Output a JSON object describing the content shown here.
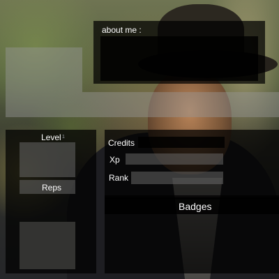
{
  "profile": {
    "about_label": "about me :",
    "level_label": "Level",
    "level_value": "1",
    "reps_label": "Reps",
    "credits_label": "Credits",
    "xp_label": "Xp",
    "rank_label": "Rank",
    "badges_label": "Badges"
  }
}
